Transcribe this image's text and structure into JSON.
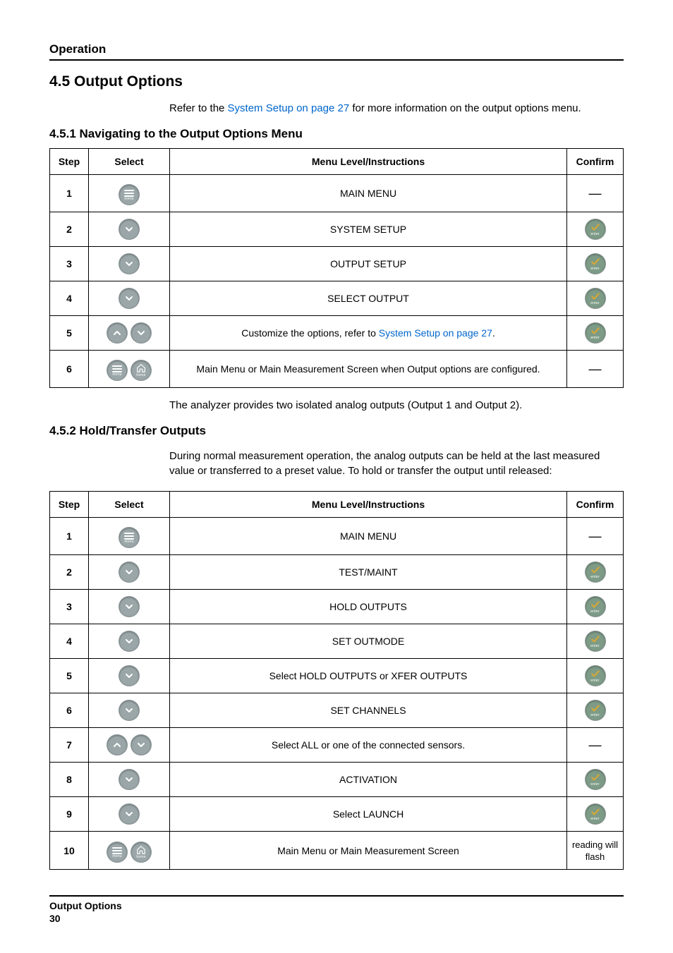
{
  "header": {
    "section_title": "Operation"
  },
  "section": {
    "number_title": "4.5  Output Options",
    "intro_prefix": "Refer to the ",
    "intro_link": "System Setup on page 27",
    "intro_suffix": " for more information on the output options menu."
  },
  "subsection1": {
    "title": "4.5.1  Navigating to the Output Options Menu",
    "columns": {
      "step": "Step",
      "select": "Select",
      "instructions": "Menu Level/Instructions",
      "confirm": "Confirm"
    },
    "rows": [
      {
        "step": "1",
        "select_icons": [
          "menu"
        ],
        "instruction": "MAIN MENU",
        "confirm_icon": "dash"
      },
      {
        "step": "2",
        "select_icons": [
          "down"
        ],
        "instruction": "SYSTEM SETUP",
        "confirm_icon": "enter"
      },
      {
        "step": "3",
        "select_icons": [
          "down"
        ],
        "instruction": "OUTPUT SETUP",
        "confirm_icon": "enter"
      },
      {
        "step": "4",
        "select_icons": [
          "down"
        ],
        "instruction": "SELECT OUTPUT",
        "confirm_icon": "enter"
      },
      {
        "step": "5",
        "select_icons": [
          "up",
          "down"
        ],
        "instruction_prefix": "Customize the options, refer to ",
        "instruction_link": "System Setup on page 27",
        "instruction_suffix": ".",
        "confirm_icon": "enter"
      },
      {
        "step": "6",
        "select_icons": [
          "menu",
          "home"
        ],
        "instruction": "Main Menu or Main Measurement Screen when Output options are configured.",
        "confirm_icon": "dash"
      }
    ],
    "after_text": "The analyzer provides two isolated analog outputs (Output 1 and Output 2)."
  },
  "subsection2": {
    "title": "4.5.2  Hold/Transfer Outputs",
    "intro": "During normal measurement operation, the analog outputs can be held at the last measured value or transferred to a preset value. To hold or transfer the output until released:",
    "columns": {
      "step": "Step",
      "select": "Select",
      "instructions": "Menu Level/Instructions",
      "confirm": "Confirm"
    },
    "rows": [
      {
        "step": "1",
        "select_icons": [
          "menu"
        ],
        "instruction": "MAIN MENU",
        "confirm_icon": "dash"
      },
      {
        "step": "2",
        "select_icons": [
          "down"
        ],
        "instruction": "TEST/MAINT",
        "confirm_icon": "enter"
      },
      {
        "step": "3",
        "select_icons": [
          "down"
        ],
        "instruction": "HOLD OUTPUTS",
        "confirm_icon": "enter"
      },
      {
        "step": "4",
        "select_icons": [
          "down"
        ],
        "instruction": "SET OUTMODE",
        "confirm_icon": "enter"
      },
      {
        "step": "5",
        "select_icons": [
          "down"
        ],
        "instruction": "Select HOLD OUTPUTS or XFER OUTPUTS",
        "confirm_icon": "enter"
      },
      {
        "step": "6",
        "select_icons": [
          "down"
        ],
        "instruction": "SET CHANNELS",
        "confirm_icon": "enter"
      },
      {
        "step": "7",
        "select_icons": [
          "up",
          "down"
        ],
        "instruction": "Select ALL or one of the connected sensors.",
        "confirm_icon": "dash"
      },
      {
        "step": "8",
        "select_icons": [
          "down"
        ],
        "instruction": "ACTIVATION",
        "confirm_icon": "enter"
      },
      {
        "step": "9",
        "select_icons": [
          "down"
        ],
        "instruction": "Select LAUNCH",
        "confirm_icon": "enter"
      },
      {
        "step": "10",
        "select_icons": [
          "menu",
          "home"
        ],
        "instruction": "Main Menu or Main Measurement Screen",
        "confirm_text": "reading will flash"
      }
    ]
  },
  "footer": {
    "line1": "Output Options",
    "line2": "30"
  },
  "icon_labels": {
    "menu": "menu",
    "home": "home",
    "enter": "enter"
  }
}
